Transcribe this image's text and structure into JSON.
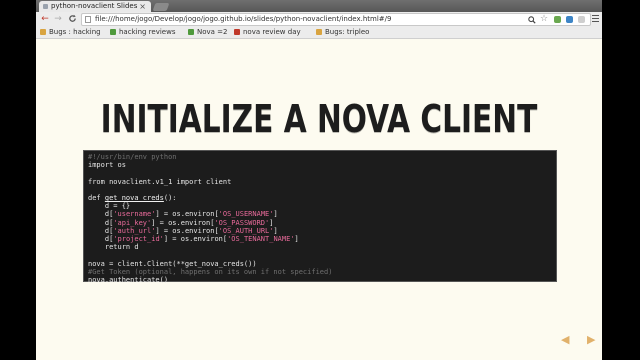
{
  "browser": {
    "tab_title": "python-novaclient Slides",
    "tab_close": "×",
    "nav": {
      "back": "←",
      "forward": "→",
      "reload": "C"
    },
    "url": "file:///home/jogo/Develop/jogo/jogo.github.io/slides/python-novaclient/index.html#/9",
    "icons": {
      "zoom": "zoom-icon",
      "star": "star-icon",
      "menu": "menu-icon"
    }
  },
  "bookmarks": [
    {
      "label": "Bugs : hacking",
      "color": "#d9a440"
    },
    {
      "label": "hacking reviews",
      "color": "#4f9a3c"
    },
    {
      "label": "Nova =2",
      "color": "#4f9a3c"
    },
    {
      "label": "nova review day",
      "color": "#c0392b"
    },
    {
      "label": "Bugs: tripleo",
      "color": "#d9a440"
    }
  ],
  "slide": {
    "title": "INITIALIZE A NOVA CLIENT",
    "code_lines": [
      {
        "parts": [
          {
            "t": "#!/usr/bin/env python",
            "c": "comment"
          }
        ]
      },
      {
        "parts": [
          {
            "t": "import os",
            "c": ""
          }
        ]
      },
      {
        "parts": [
          {
            "t": "",
            "c": ""
          }
        ]
      },
      {
        "parts": [
          {
            "t": "from novaclient.v1_1 import client",
            "c": ""
          }
        ]
      },
      {
        "parts": [
          {
            "t": "",
            "c": ""
          }
        ]
      },
      {
        "parts": [
          {
            "t": "def ",
            "c": ""
          },
          {
            "t": "get_nova_creds",
            "c": "fn"
          },
          {
            "t": "():",
            "c": ""
          }
        ]
      },
      {
        "parts": [
          {
            "t": "    d = {}",
            "c": ""
          }
        ]
      },
      {
        "parts": [
          {
            "t": "    d[",
            "c": ""
          },
          {
            "t": "'username'",
            "c": "str"
          },
          {
            "t": "] = os.environ[",
            "c": ""
          },
          {
            "t": "'OS_USERNAME'",
            "c": "str"
          },
          {
            "t": "]",
            "c": ""
          }
        ]
      },
      {
        "parts": [
          {
            "t": "    d[",
            "c": ""
          },
          {
            "t": "'api_key'",
            "c": "str"
          },
          {
            "t": "] = os.environ[",
            "c": ""
          },
          {
            "t": "'OS_PASSWORD'",
            "c": "str"
          },
          {
            "t": "]",
            "c": ""
          }
        ]
      },
      {
        "parts": [
          {
            "t": "    d[",
            "c": ""
          },
          {
            "t": "'auth_url'",
            "c": "str"
          },
          {
            "t": "] = os.environ[",
            "c": ""
          },
          {
            "t": "'OS_AUTH_URL'",
            "c": "str"
          },
          {
            "t": "]",
            "c": ""
          }
        ]
      },
      {
        "parts": [
          {
            "t": "    d[",
            "c": ""
          },
          {
            "t": "'project_id'",
            "c": "str"
          },
          {
            "t": "] = os.environ[",
            "c": ""
          },
          {
            "t": "'OS_TENANT_NAME'",
            "c": "str"
          },
          {
            "t": "]",
            "c": ""
          }
        ]
      },
      {
        "parts": [
          {
            "t": "    return d",
            "c": ""
          }
        ]
      },
      {
        "parts": [
          {
            "t": "",
            "c": ""
          }
        ]
      },
      {
        "parts": [
          {
            "t": "nova = client.Client(**get_nova_creds())",
            "c": ""
          }
        ]
      },
      {
        "parts": [
          {
            "t": "#Get Token (optional, happens on its own if not specified)",
            "c": "comment"
          }
        ]
      },
      {
        "parts": [
          {
            "t": "nova.authenticate()",
            "c": ""
          }
        ]
      }
    ]
  },
  "controls": {
    "prev": "◀",
    "next": "▶"
  },
  "colors": {
    "accent_arrow": "#e1b16b",
    "code_bg": "#1c1c1c",
    "slide_bg": "#fdfbf0"
  }
}
